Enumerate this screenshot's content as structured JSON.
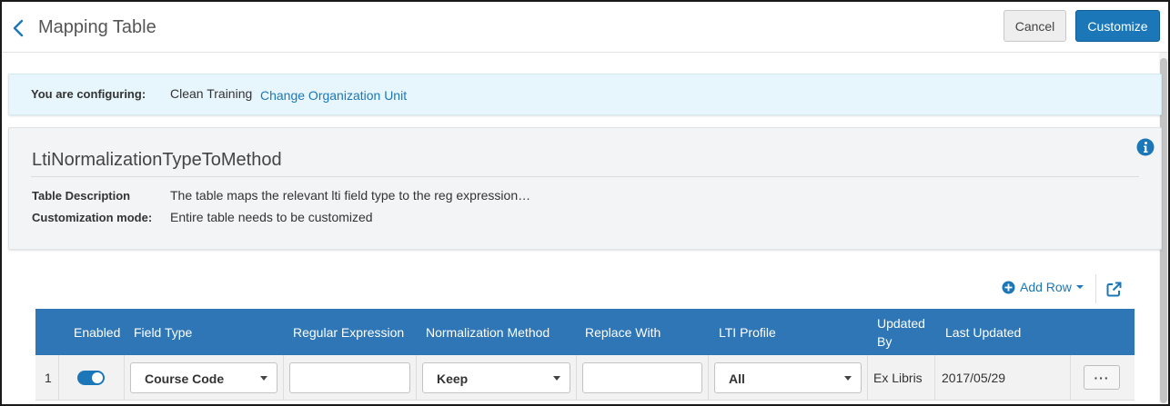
{
  "header": {
    "title": "Mapping Table",
    "cancel_label": "Cancel",
    "customize_label": "Customize"
  },
  "config": {
    "label": "You are configuring:",
    "value": "Clean Training",
    "change_link": "Change Organization Unit"
  },
  "info": {
    "table_name": "LtiNormalizationTypeToMethod",
    "description_label": "Table Description",
    "description_value": "The table maps the relevant lti field type to the reg expression…",
    "mode_label": "Customization mode:",
    "mode_value": "Entire table needs to be customized"
  },
  "toolbar": {
    "add_row_label": "Add Row"
  },
  "table": {
    "columns": {
      "enabled": "Enabled",
      "field_type": "Field Type",
      "regular_expression": "Regular Expression",
      "normalization_method": "Normalization Method",
      "replace_with": "Replace With",
      "lti_profile": "LTI Profile",
      "updated_by_line1": "Updated",
      "updated_by_line2": "By",
      "last_updated": "Last Updated"
    },
    "rows": [
      {
        "index": "1",
        "enabled": true,
        "field_type": "Course Code",
        "regular_expression": "",
        "normalization_method": "Keep",
        "replace_with": "",
        "lti_profile": "All",
        "updated_by": "Ex Libris",
        "last_updated": "2017/05/29",
        "actions_label": "···"
      }
    ]
  },
  "colors": {
    "accent": "#1c77b8",
    "table_header": "#2e76b6",
    "banner_bg": "#e7f6fc",
    "panel_bg": "#f2f4f5"
  },
  "icons": {
    "back": "chevron-left-icon",
    "info": "info-icon",
    "add": "plus-circle-icon",
    "export": "external-link-icon"
  }
}
